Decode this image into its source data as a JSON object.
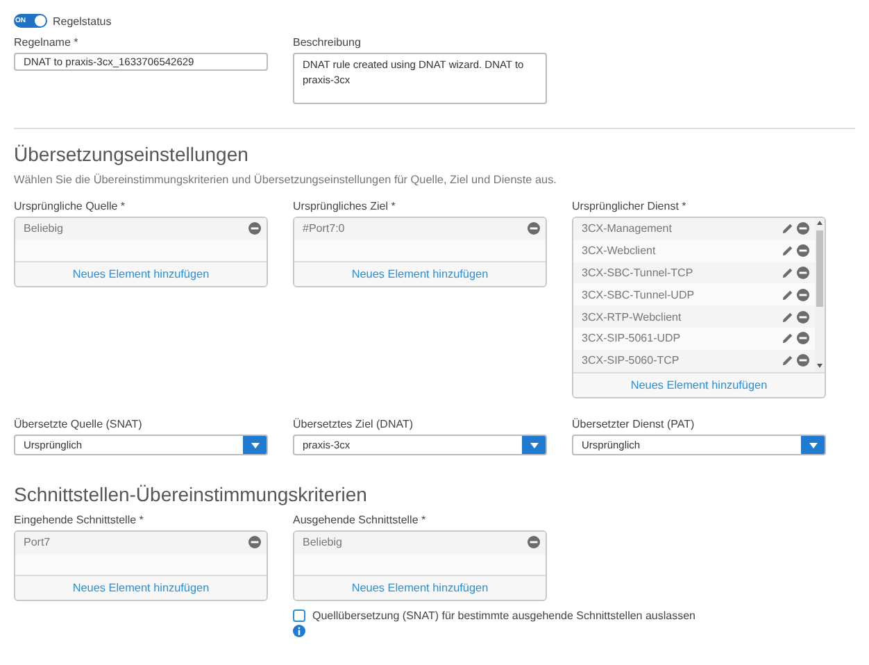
{
  "status_toggle": {
    "on_label": "ON",
    "label": "Regelstatus",
    "on": true
  },
  "rule_name": {
    "label": "Regelname *",
    "value": "DNAT to praxis-3cx_1633706542629"
  },
  "description": {
    "label": "Beschreibung",
    "value": "DNAT rule created using DNAT wizard. DNAT to praxis-3cx"
  },
  "translation": {
    "heading": "Übersetzungseinstellungen",
    "subtitle": "Wählen Sie die Übereinstimmungskriterien und Übersetzungseinstellungen für Quelle, Ziel und Dienste aus.",
    "original": [
      {
        "label": "Ursprüngliche Quelle *",
        "add_label": "Neues Element hinzufügen",
        "scrollable": false,
        "items": [
          {
            "text": "Beliebig",
            "kind": "plain"
          }
        ]
      },
      {
        "label": "Ursprüngliches Ziel *",
        "add_label": "Neues Element hinzufügen",
        "scrollable": false,
        "items": [
          {
            "text": "#Port7:0",
            "kind": "plain"
          }
        ]
      },
      {
        "label": "Ursprünglicher Dienst *",
        "add_label": "Neues Element hinzufügen",
        "scrollable": true,
        "items": [
          {
            "text": "3CX-Management",
            "kind": "editable"
          },
          {
            "text": "3CX-Webclient",
            "kind": "editable"
          },
          {
            "text": "3CX-SBC-Tunnel-TCP",
            "kind": "editable"
          },
          {
            "text": "3CX-SBC-Tunnel-UDP",
            "kind": "editable"
          },
          {
            "text": "3CX-RTP-Webclient",
            "kind": "editable"
          },
          {
            "text": "3CX-SIP-5061-UDP",
            "kind": "editable"
          },
          {
            "text": "3CX-SIP-5060-TCP",
            "kind": "editable"
          }
        ]
      }
    ],
    "translated": [
      {
        "label": "Übersetzte Quelle (SNAT)",
        "value": "Ursprünglich"
      },
      {
        "label": "Übersetztes Ziel (DNAT)",
        "value": "praxis-3cx"
      },
      {
        "label": "Übersetzter Dienst (PAT)",
        "value": "Ursprünglich"
      }
    ]
  },
  "interfaces": {
    "heading": "Schnittstellen-Übereinstimmungskriterien",
    "lists": [
      {
        "label": "Eingehende Schnittstelle *",
        "add_label": "Neues Element hinzufügen",
        "scrollable": false,
        "items": [
          {
            "text": "Port7",
            "kind": "plain"
          }
        ]
      },
      {
        "label": "Ausgehende Schnittstelle *",
        "add_label": "Neues Element hinzufügen",
        "scrollable": false,
        "items": [
          {
            "text": "Beliebig",
            "kind": "plain"
          }
        ]
      }
    ],
    "exclude_checkbox": {
      "label": "Quellübersetzung (SNAT) für bestimmte ausgehende Schnittstellen auslassen",
      "checked": false
    }
  }
}
